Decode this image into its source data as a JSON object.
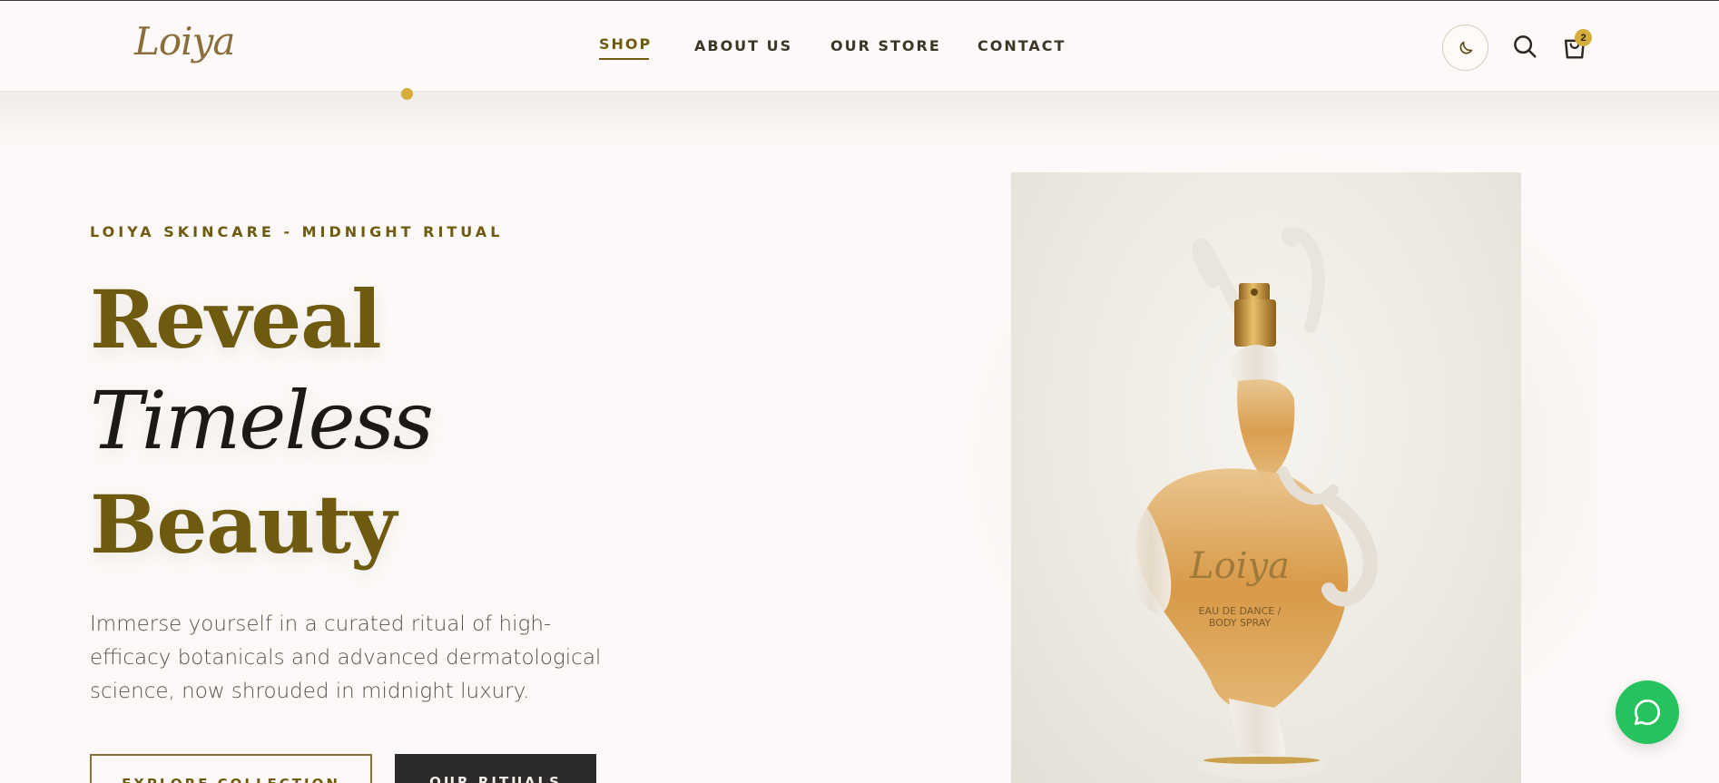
{
  "brand": {
    "logo_text": "Loiya",
    "accent": "#6e5b10",
    "gold": "#d4ad3a"
  },
  "nav": {
    "items": [
      {
        "label": "SHOP",
        "active": true
      },
      {
        "label": "ABOUT US",
        "active": false
      },
      {
        "label": "OUR STORE",
        "active": false
      },
      {
        "label": "CONTACT",
        "active": false
      }
    ]
  },
  "header_actions": {
    "theme_toggle_icon": "moon-icon",
    "search_icon": "search-icon",
    "cart_icon": "cart-icon",
    "cart_count": "2"
  },
  "hero": {
    "kicker": "LOIYA SKINCARE - MIDNIGHT RITUAL",
    "headline_line1": "Reveal",
    "headline_line2": "Timeless",
    "headline_line3": "Beauty",
    "description": "Immerse yourself in a curated ritual of high-efficacy botanicals and advanced dermatological science, now shrouded in midnight luxury.",
    "primary_button": "EXPLORE COLLECTION",
    "secondary_button": "OUR RITUALS"
  },
  "product_image": {
    "label_logo": "Loiya",
    "label_line1": "EAU DE DANCE /",
    "label_line2": "BODY SPRAY"
  },
  "chat": {
    "icon": "chat-icon",
    "color": "#25c25d"
  }
}
